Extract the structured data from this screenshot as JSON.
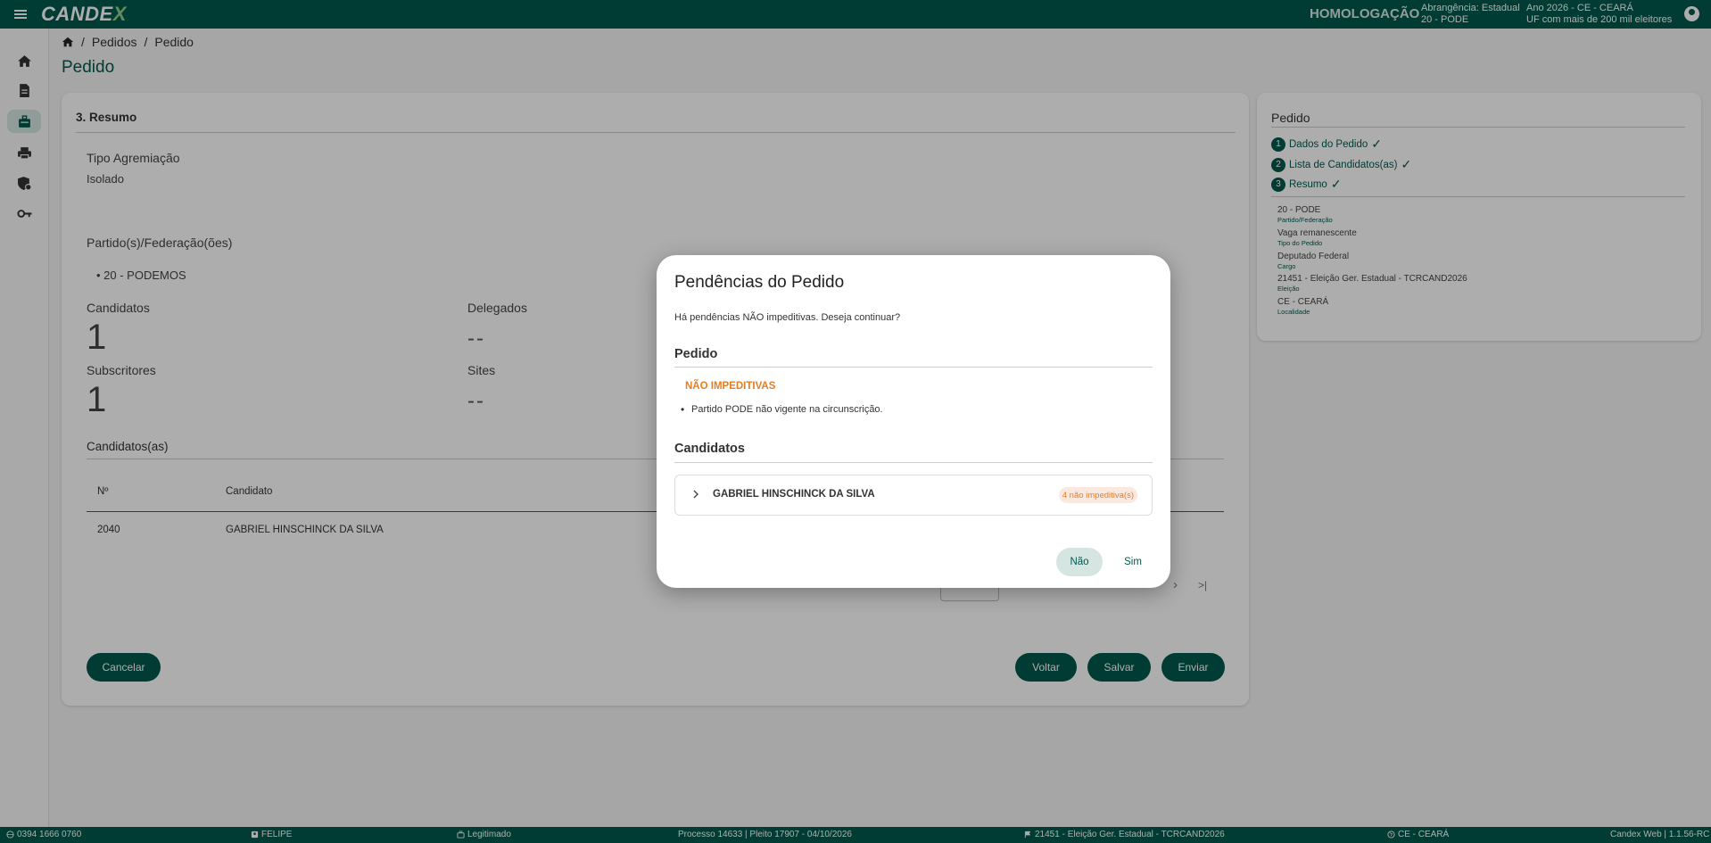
{
  "header": {
    "logo": "CANDEX",
    "environment": "HOMOLOGAÇÃO",
    "scope_line1": "Abrangência: Estadual",
    "scope_line2": "20 - PODE",
    "year_line1": "Ano 2026 - CE - CEARÁ",
    "year_line2": "UF com mais de 200 mil eleitores"
  },
  "sidebar": {
    "items": [
      {
        "icon": "home-icon"
      },
      {
        "icon": "document-icon"
      },
      {
        "icon": "briefcase-icon",
        "active": true
      },
      {
        "icon": "printer-icon"
      },
      {
        "icon": "shield-gear-icon"
      },
      {
        "icon": "key-icon"
      }
    ]
  },
  "breadcrumb": {
    "sep": "/",
    "items": [
      "Pedidos",
      "Pedido"
    ]
  },
  "page": {
    "title": "Pedido"
  },
  "summary": {
    "header": "3. Resumo",
    "tipo_label": "Tipo Agremiação",
    "tipo_value": "Isolado",
    "partidos_label": "Partido(s)/Federação(ões)",
    "partidos": [
      "20 - PODEMOS"
    ],
    "candidatos_label": "Candidatos",
    "candidatos_value": "1",
    "delegados_label": "Delegados",
    "delegados_value": "--",
    "subscritores_label": "Subscritores",
    "subscritores_value": "1",
    "sites_label": "Sites",
    "sites_value": "--",
    "table_label": "Candidatos(as)",
    "table": {
      "headers": [
        "Nº",
        "Candidato"
      ],
      "rows": [
        [
          "2040",
          "GABRIEL HINSCHINCK DA SILVA"
        ]
      ]
    },
    "pager_next": "›",
    "pager_last": ">|",
    "buttons": {
      "cancel": "Cancelar",
      "back": "Voltar",
      "save": "Salvar",
      "send": "Enviar"
    }
  },
  "side_panel": {
    "title": "Pedido",
    "steps": [
      {
        "num": "1",
        "label": "Dados do Pedido"
      },
      {
        "num": "2",
        "label": "Lista de Candidatos(as)"
      },
      {
        "num": "3",
        "label": "Resumo"
      }
    ],
    "check": "✓",
    "details": [
      {
        "value": "20 - PODE",
        "label": "Partido/Federação"
      },
      {
        "value": "Vaga remanescente",
        "label": "Tipo do Pedido"
      },
      {
        "value": "Deputado Federal",
        "label": "Cargo"
      },
      {
        "value": "21451 - Eleição Ger. Estadual - TCRCAND2026",
        "label": "Eleição"
      },
      {
        "value": "CE - CEARÁ",
        "label": "Localidade"
      }
    ]
  },
  "dialog": {
    "title": "Pendências do Pedido",
    "question": "Há pendências NÃO impeditivas. Deseja continuar?",
    "pedido_heading": "Pedido",
    "nonimp_heading": "NÃO IMPEDITIVAS",
    "pedido_items": [
      "Partido PODE não vigente na circunscrição."
    ],
    "candidatos_heading": "Candidatos",
    "candidate_name": "GABRIEL HINSCHINCK DA SILVA",
    "candidate_badge": "4 não impeditiva(s)",
    "no_label": "Não",
    "yes_label": "Sim"
  },
  "footer": {
    "phone": "0394 1666 0760",
    "user": "FELIPE",
    "status": "Legitimado",
    "process": "Processo 14633 | Pleito 17907 - 04/10/2026",
    "election": "21451 - Eleição Ger. Estadual - TCRCAND2026",
    "location": "CE - CEARÁ",
    "version": "Candex Web | 1.1.56-RC"
  },
  "colors": {
    "primary": "#00594c",
    "warning": "#e67e22",
    "active_bg": "#d5e6e2"
  }
}
